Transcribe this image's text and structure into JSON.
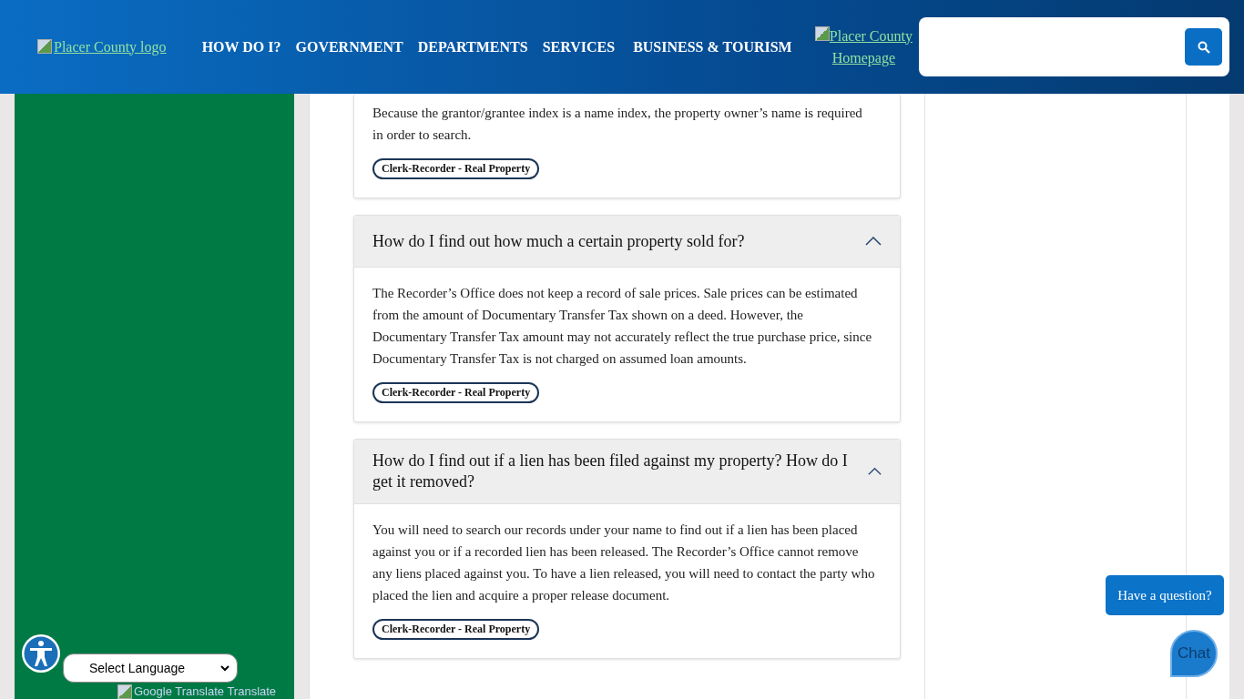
{
  "header": {
    "logo_alt": "Placer County logo",
    "nav": [
      "HOW DO I?",
      "GOVERNMENT",
      "DEPARTMENTS",
      "SERVICES",
      "BUSINESS & TOURISM"
    ],
    "home_alt": "Placer County Homepage"
  },
  "faqs": [
    {
      "body_before": "Because the grantor/grantee index is a name index, the property owner’s name is required in order to search.",
      "tag": "Clerk-Recorder - Real Property"
    },
    {
      "question": "How do I find out how much a certain property sold for?",
      "expanded": true,
      "body_before": "The Recorder’s Office does not keep a record of sale prices. Sale prices can be estimated from the amount of Documentary Transfer Tax shown on a deed. However, the Documentary Transfer Tax amount may not accurately reflect the true purchase price, since Documentary Transfer Tax is not charged on assumed loan amounts.",
      "tag": "Clerk-Recorder - Real Property"
    },
    {
      "question": "How do I find out if a lien has been filed against my property? How do I get it removed?",
      "expanded": true,
      "body_before": "You will need to search our records under your name to find out if a lien has been placed against you or if a recorded lien has been released. The Recorder’s Office cannot remove any liens placed against you. To have a lien released, you will need to contact the party who placed the lien and acquire a proper release document.",
      "tag": "Clerk-Recorder - Real Property"
    }
  ],
  "widgets": {
    "language": "Select Language",
    "translate_alt": "Google Translate Translate",
    "question_button": "Have a question?",
    "chat_alt": "Chat"
  }
}
